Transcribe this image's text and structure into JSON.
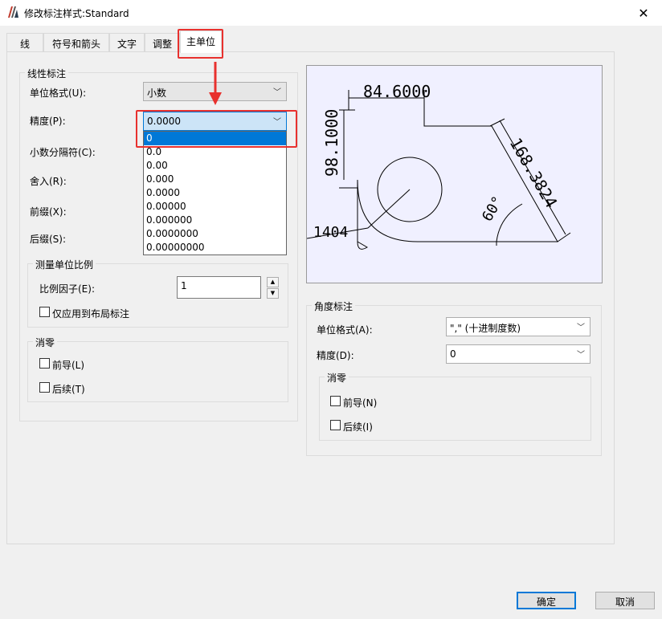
{
  "window": {
    "title": "修改标注样式:Standard",
    "close": "✕"
  },
  "tabs": [
    "线",
    "符号和箭头",
    "文字",
    "调整",
    "主单位"
  ],
  "linear": {
    "title": "线性标注",
    "unit_format_label": "单位格式(U):",
    "unit_format_value": "小数",
    "precision_label": "精度(P):",
    "precision_value": "0.0000",
    "decimal_sep_label": "小数分隔符(C):",
    "round_label": "舍入(R):",
    "prefix_label": "前缀(X):",
    "suffix_label": "后缀(S):",
    "precision_options": [
      "0",
      "0.0",
      "0.00",
      "0.000",
      "0.0000",
      "0.00000",
      "0.000000",
      "0.0000000",
      "0.00000000"
    ]
  },
  "scale": {
    "title": "测量单位比例",
    "factor_label": "比例因子(E):",
    "factor_value": "1",
    "layout_only_label": "仅应用到布局标注"
  },
  "zero_linear": {
    "title": "消零",
    "leading_label": "前导(L)",
    "trailing_label": "后续(T)"
  },
  "preview": {
    "dim_top": "84.6000",
    "dim_left": "98.1000",
    "dim_diag": "168.3824",
    "dim_angle": "60°",
    "dim_bottom": "1404"
  },
  "angular": {
    "title": "角度标注",
    "unit_format_label": "单位格式(A):",
    "unit_format_value": "\",\" (十进制度数)",
    "precision_label": "精度(D):",
    "precision_value": "0"
  },
  "zero_angular": {
    "title": "消零",
    "leading_label": "前导(N)",
    "trailing_label": "后续(I)"
  },
  "buttons": {
    "ok": "确定",
    "cancel": "取消"
  },
  "colors": {
    "annotation": "#e8312e",
    "selection": "#0078d7"
  }
}
